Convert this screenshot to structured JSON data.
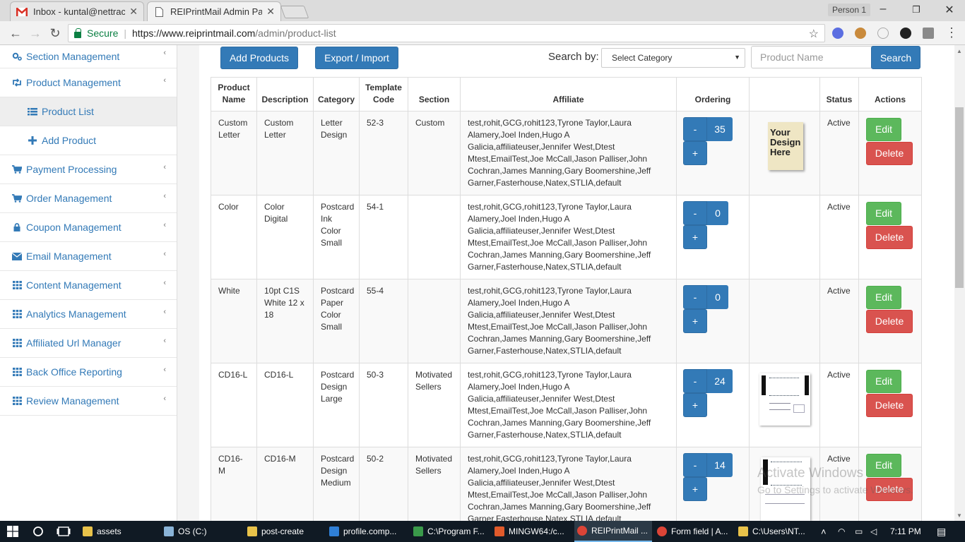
{
  "browser": {
    "tabs": [
      {
        "title": "Inbox - kuntal@nettracke",
        "icon": "gmail-icon"
      },
      {
        "title": "REIPrintMail Admin Panel",
        "icon": "page-icon"
      }
    ],
    "profile": "Person 1",
    "secure_label": "Secure",
    "url_host": "https://www.reiprintmail.com",
    "url_path": "/admin/product-list"
  },
  "sidebar": {
    "items": [
      {
        "label": "Section Management",
        "icon": "gears-icon"
      },
      {
        "label": "Product Management",
        "icon": "retweet-icon"
      },
      {
        "label": "Product List",
        "icon": "list-icon"
      },
      {
        "label": "Add Product",
        "icon": "plus-icon"
      },
      {
        "label": "Payment Processing",
        "icon": "cart-icon"
      },
      {
        "label": "Order Management",
        "icon": "cart-icon"
      },
      {
        "label": "Coupon Management",
        "icon": "lock-icon"
      },
      {
        "label": "Email Management",
        "icon": "envelope-icon"
      },
      {
        "label": "Content Management",
        "icon": "grid-icon"
      },
      {
        "label": "Analytics Management",
        "icon": "grid-icon"
      },
      {
        "label": "Affiliated Url Manager",
        "icon": "grid-icon"
      },
      {
        "label": "Back Office Reporting",
        "icon": "grid-icon"
      },
      {
        "label": "Review Management",
        "icon": "grid-icon"
      }
    ]
  },
  "toolbar": {
    "add_products": "Add Products",
    "export_import": "Export / Import",
    "search_by": "Search by:",
    "category_select": "Select Category",
    "product_name_placeholder": "Product Name",
    "search": "Search"
  },
  "table": {
    "headers": [
      "Product Name",
      "Description",
      "Category",
      "Template Code",
      "Section",
      "Affiliate",
      "Ordering",
      "",
      "Status",
      "Actions"
    ],
    "edit_label": "Edit",
    "delete_label": "Delete",
    "minus_label": "-",
    "plus_label": "+",
    "rows": [
      {
        "name": "Custom Letter",
        "description": "Custom Letter",
        "category": "Letter Design",
        "template_code": "52-3",
        "section": "Custom",
        "affiliate": "test,rohit,GCG,rohit123,Tyrone Taylor,Laura Alamery,Joel Inden,Hugo A Galicia,affiliateuser,Jennifer West,Dtest Mtest,EmailTest,Joe McCall,Jason Palliser,John Cochran,James Manning,Gary Boomershine,Jeff Garner,Fasterhouse,Natex,STLIA,default",
        "ordering": "35",
        "image": "your-design-here",
        "status": "Active"
      },
      {
        "name": "Color",
        "description": "Color Digital",
        "category": "Postcard Ink Color Small",
        "template_code": "54-1",
        "section": "",
        "affiliate": "test,rohit,GCG,rohit123,Tyrone Taylor,Laura Alamery,Joel Inden,Hugo A Galicia,affiliateuser,Jennifer West,Dtest Mtest,EmailTest,Joe McCall,Jason Palliser,John Cochran,James Manning,Gary Boomershine,Jeff Garner,Fasterhouse,Natex,STLIA,default",
        "ordering": "0",
        "image": "",
        "status": "Active"
      },
      {
        "name": "White",
        "description": "10pt C1S White 12 x 18",
        "category": "Postcard Paper Color Small",
        "template_code": "55-4",
        "section": "",
        "affiliate": "test,rohit,GCG,rohit123,Tyrone Taylor,Laura Alamery,Joel Inden,Hugo A Galicia,affiliateuser,Jennifer West,Dtest Mtest,EmailTest,Joe McCall,Jason Palliser,John Cochran,James Manning,Gary Boomershine,Jeff Garner,Fasterhouse,Natex,STLIA,default",
        "ordering": "0",
        "image": "",
        "status": "Active"
      },
      {
        "name": "CD16-L",
        "description": "CD16-L",
        "category": "Postcard Design Large",
        "template_code": "50-3",
        "section": "Motivated Sellers",
        "affiliate": "test,rohit,GCG,rohit123,Tyrone Taylor,Laura Alamery,Joel Inden,Hugo A Galicia,affiliateuser,Jennifer West,Dtest Mtest,EmailTest,Joe McCall,Jason Palliser,John Cochran,James Manning,Gary Boomershine,Jeff Garner,Fasterhouse,Natex,STLIA,default",
        "ordering": "24",
        "image": "postcard-thumb",
        "status": "Active"
      },
      {
        "name": "CD16-M",
        "description": "CD16-M",
        "category": "Postcard Design Medium",
        "template_code": "50-2",
        "section": "Motivated Sellers",
        "affiliate": "test,rohit,GCG,rohit123,Tyrone Taylor,Laura Alamery,Joel Inden,Hugo A Galicia,affiliateuser,Jennifer West,Dtest Mtest,EmailTest,Joe McCall,Jason Palliser,John Cochran,James Manning,Gary Boomershine,Jeff Garner,Fasterhouse,Natex,STLIA,default",
        "ordering": "14",
        "image": "postcard-thumb",
        "status": "Active"
      }
    ]
  },
  "watermark": {
    "line1": "Activate Windows",
    "line2": "Go to Settings to activate Windows."
  },
  "taskbar": {
    "items": [
      "assets",
      "OS (C:)",
      "post-create",
      "profile.comp...",
      "C:\\Program F...",
      "MINGW64:/c...",
      "REIPrintMail ...",
      "Form field | A...",
      "C:\\Users\\NT..."
    ],
    "time": "7:11 PM"
  },
  "colors": {
    "primary": "#337ab7",
    "success": "#5cb85c",
    "danger": "#d9534f"
  }
}
